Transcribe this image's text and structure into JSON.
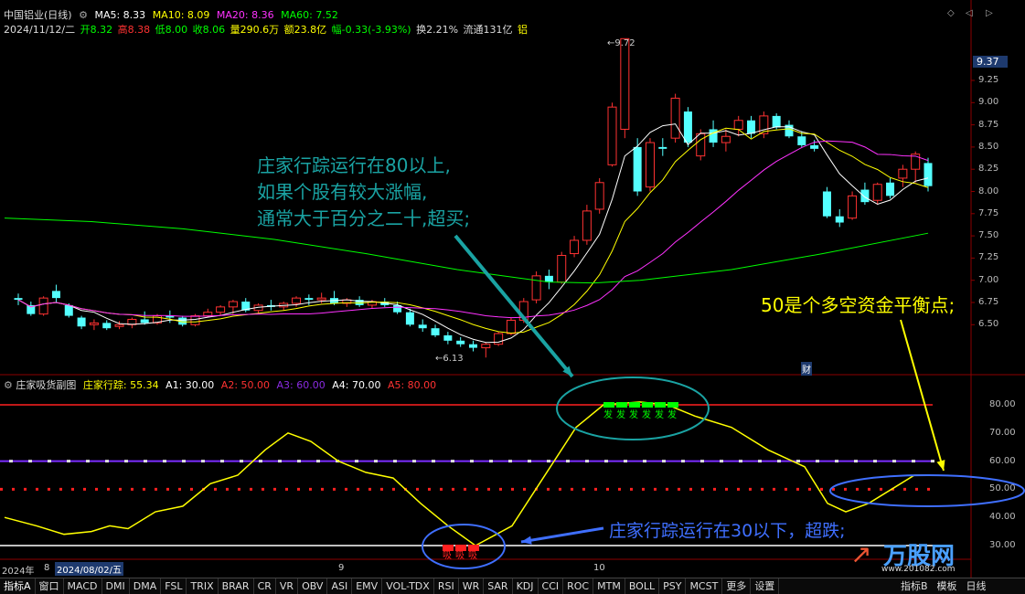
{
  "header": {
    "stock_title": "中国铝业(日线)",
    "ma5": "MA5: 8.33",
    "ma10": "MA10: 8.09",
    "ma20": "MA20: 8.36",
    "ma60": "MA60: 7.52",
    "date": "2024/11/12/二",
    "open": "开8.32",
    "high": "高8.38",
    "low": "低8.00",
    "close": "收8.06",
    "volume": "量290.6万",
    "amount": "额23.8亿",
    "change": "幅-0.33(-3.93%)",
    "turnover": "换2.21%",
    "float": "流通131亿",
    "tag": "铝"
  },
  "price_panel": {
    "current_price": "9.37",
    "y_labels": [
      "9.25",
      "9.00",
      "8.75",
      "8.50",
      "8.25",
      "8.00",
      "7.75",
      "7.50",
      "7.25",
      "7.00",
      "6.75",
      "6.50"
    ],
    "high_mark": "9.72",
    "low_mark": "6.13",
    "event_mark": "财"
  },
  "indicator_panel": {
    "title": "庄家吸货副图",
    "line_name": "庄家行踪: 55.34",
    "a1": "A1: 30.00",
    "a2": "A2: 50.00",
    "a3": "A3: 60.00",
    "a4": "A4: 70.00",
    "a5": "A5: 80.00",
    "y_labels": [
      "80.00",
      "70.00",
      "60.00",
      "50.00",
      "40.00",
      "30.00"
    ],
    "buy_marker": "吸",
    "sell_marker": "发"
  },
  "annotations": {
    "note1_line1": "庄家行踪运行在80以上,",
    "note1_line2": "如果个股有较大涨幅,",
    "note1_line3": "通常大于百分之二十,超买;",
    "note2": "50是个多空资金平衡点;",
    "note3": "庄家行踪运行在30以下，超跌;"
  },
  "date_axis": {
    "start_label": "2024年",
    "cursor_date": "2024/08/02/五",
    "month_9": "9",
    "month_10": "10",
    "small_label": "8"
  },
  "tabs": [
    "指标A",
    "窗口",
    "MACD",
    "DMI",
    "DMA",
    "FSL",
    "TRIX",
    "BRAR",
    "CR",
    "VR",
    "OBV",
    "ASI",
    "EMV",
    "VOL-TDX",
    "RSI",
    "WR",
    "SAR",
    "KDJ",
    "CCI",
    "ROC",
    "MTM",
    "BOLL",
    "PSY",
    "MCST",
    "更多",
    "设置"
  ],
  "right_tabs": {
    "tab1": "指标B",
    "tab2": "模板",
    "tab3": "日线"
  },
  "watermark": {
    "logo_text": "万股网",
    "site": "www.201082.com"
  },
  "colors": {
    "up": "#ff3232",
    "down": "#54ffff",
    "ma5": "#ffffff",
    "ma10": "#ffff00",
    "ma20": "#ff32ff",
    "ma60": "#00ff00",
    "indicator": "#ffff00",
    "annotation_cyan": "#1aa3a3",
    "annotation_yellow": "#ffff00",
    "annotation_blue": "#3f6fff"
  }
}
